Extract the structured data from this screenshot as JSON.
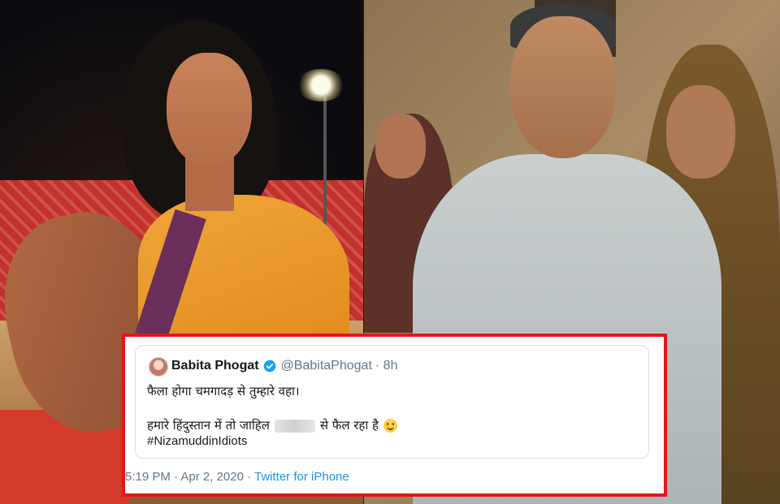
{
  "tweet": {
    "display_name": "Babita Phogat",
    "handle": "@BabitaPhogat",
    "age": "· 8h",
    "line1": "फैला होगा चमगादड़ से तुम्हारे वहा।",
    "line2_before": "हमारे हिंदुस्तान में तो जाहिल",
    "line2_after": "से फैल रहा है",
    "hashtag": "#NizamuddinIdiots",
    "timestamp": "5:19 PM · Apr 2, 2020 ·",
    "source": "Twitter for iPhone",
    "emoji": "slightly-smiling-face"
  },
  "colors": {
    "frame": "#e8141a",
    "verified": "#1da1f2",
    "link": "#1b95e0",
    "muted": "#657786"
  }
}
